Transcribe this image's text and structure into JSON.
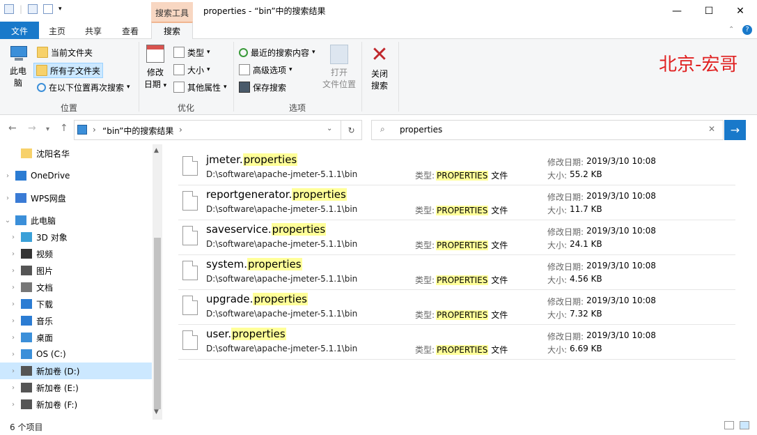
{
  "titlebar": {
    "context_tab": "搜索工具",
    "title": "properties - “bin”中的搜索结果",
    "minimize": "—",
    "maximize": "☐",
    "close": "✕"
  },
  "tabs": {
    "file": "文件",
    "home": "主页",
    "share": "共享",
    "view": "查看",
    "search": "搜索"
  },
  "ribbon": {
    "location": {
      "this_pc": "此电\n脑",
      "this_pc_1": "此电",
      "this_pc_2": "脑",
      "current_folder": "当前文件夹",
      "all_subfolders": "所有子文件夹",
      "search_again": "在以下位置再次搜索",
      "label": "位置"
    },
    "refine": {
      "date_modified_1": "修改",
      "date_modified_2": "日期",
      "kind": "类型",
      "size": "大小",
      "other_props": "其他属性",
      "label": "优化"
    },
    "options": {
      "recent": "最近的搜索内容",
      "advanced": "高级选项",
      "save": "保存搜索",
      "open_location_1": "打开",
      "open_location_2": "文件位置",
      "label": "选项"
    },
    "close_search_1": "关闭",
    "close_search_2": "搜索"
  },
  "watermark": "北京-宏哥",
  "address": {
    "path": "“bin”中的搜索结果",
    "search_value": "properties"
  },
  "nav": [
    {
      "label": "沈阳名华",
      "level": 1,
      "chev": "",
      "sel": false
    },
    {
      "label": "OneDrive",
      "level": 0,
      "chev": "›",
      "sel": false
    },
    {
      "label": "WPS网盘",
      "level": 0,
      "chev": "›",
      "sel": false
    },
    {
      "label": "此电脑",
      "level": 0,
      "chev": "⌄",
      "sel": false
    },
    {
      "label": "3D 对象",
      "level": 1,
      "chev": "›",
      "sel": false
    },
    {
      "label": "视频",
      "level": 1,
      "chev": "›",
      "sel": false
    },
    {
      "label": "图片",
      "level": 1,
      "chev": "›",
      "sel": false
    },
    {
      "label": "文档",
      "level": 1,
      "chev": "›",
      "sel": false
    },
    {
      "label": "下载",
      "level": 1,
      "chev": "›",
      "sel": false
    },
    {
      "label": "音乐",
      "level": 1,
      "chev": "›",
      "sel": false
    },
    {
      "label": "桌面",
      "level": 1,
      "chev": "›",
      "sel": false
    },
    {
      "label": "OS (C:)",
      "level": 1,
      "chev": "›",
      "sel": false
    },
    {
      "label": "新加卷 (D:)",
      "level": 1,
      "chev": "›",
      "sel": true
    },
    {
      "label": "新加卷 (E:)",
      "level": 1,
      "chev": "›",
      "sel": false
    },
    {
      "label": "新加卷 (F:)",
      "level": 1,
      "chev": "›",
      "sel": false
    }
  ],
  "results": [
    {
      "name_prefix": "jmeter.",
      "name_match": "properties",
      "path": "D:\\software\\apache-jmeter-5.1.1\\bin",
      "date": "2019/3/10 10:08",
      "size": "55.2 KB"
    },
    {
      "name_prefix": "reportgenerator.",
      "name_match": "properties",
      "path": "D:\\software\\apache-jmeter-5.1.1\\bin",
      "date": "2019/3/10 10:08",
      "size": "11.7 KB"
    },
    {
      "name_prefix": "saveservice.",
      "name_match": "properties",
      "path": "D:\\software\\apache-jmeter-5.1.1\\bin",
      "date": "2019/3/10 10:08",
      "size": "24.1 KB"
    },
    {
      "name_prefix": "system.",
      "name_match": "properties",
      "path": "D:\\software\\apache-jmeter-5.1.1\\bin",
      "date": "2019/3/10 10:08",
      "size": "4.56 KB"
    },
    {
      "name_prefix": "upgrade.",
      "name_match": "properties",
      "path": "D:\\software\\apache-jmeter-5.1.1\\bin",
      "date": "2019/3/10 10:08",
      "size": "7.32 KB"
    },
    {
      "name_prefix": "user.",
      "name_match": "properties",
      "path": "D:\\software\\apache-jmeter-5.1.1\\bin",
      "date": "2019/3/10 10:08",
      "size": "6.69 KB"
    }
  ],
  "result_labels": {
    "type_label": "类型:",
    "type_value": "PROPERTIES",
    "type_suffix": " 文件",
    "date_label": "修改日期:",
    "size_label": "大小:"
  },
  "status": "6 个项目"
}
